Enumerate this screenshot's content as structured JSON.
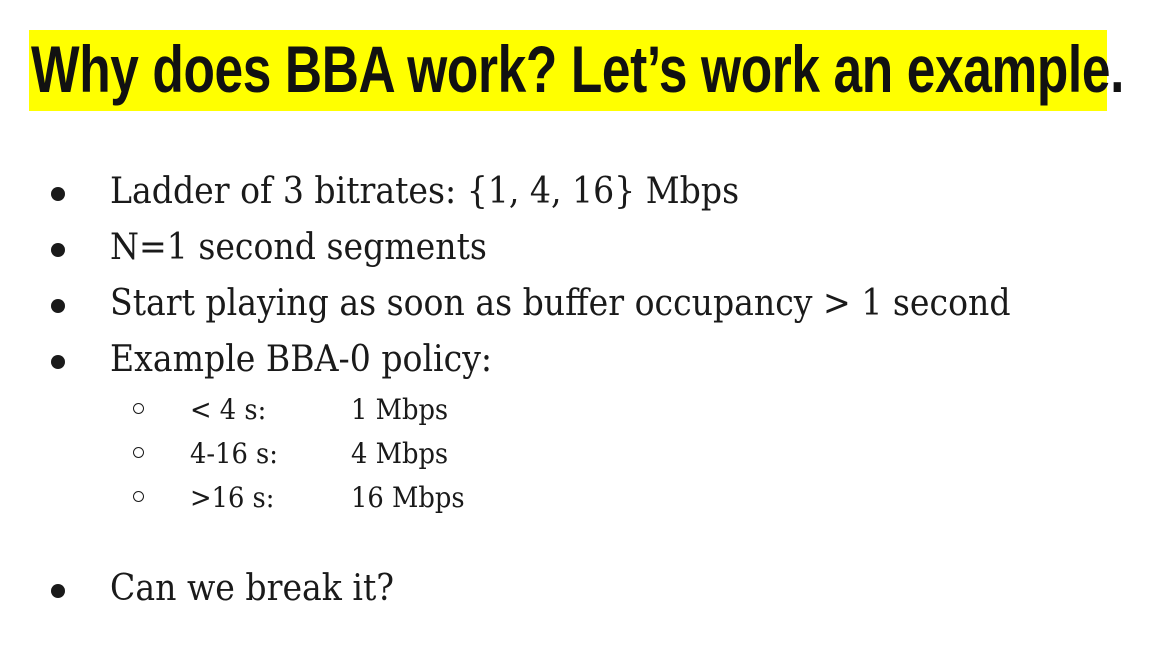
{
  "slide": {
    "title": "Why does BBA work? Let’s work an example.",
    "title_highlight_color": "#ffff00",
    "bullets": [
      "Ladder of 3 bitrates: {1, 4, 16} Mbps",
      "N=1 second segments",
      "Start playing as soon as buffer occupancy > 1 second",
      "Example BBA-0 policy:"
    ],
    "policy": [
      {
        "range": "< 4 s:",
        "rate": "1 Mbps"
      },
      {
        "range": "4-16 s:",
        "rate": "4 Mbps"
      },
      {
        "range": ">16 s:",
        "rate": "16 Mbps"
      }
    ],
    "final_bullet": "Can we break it?"
  }
}
